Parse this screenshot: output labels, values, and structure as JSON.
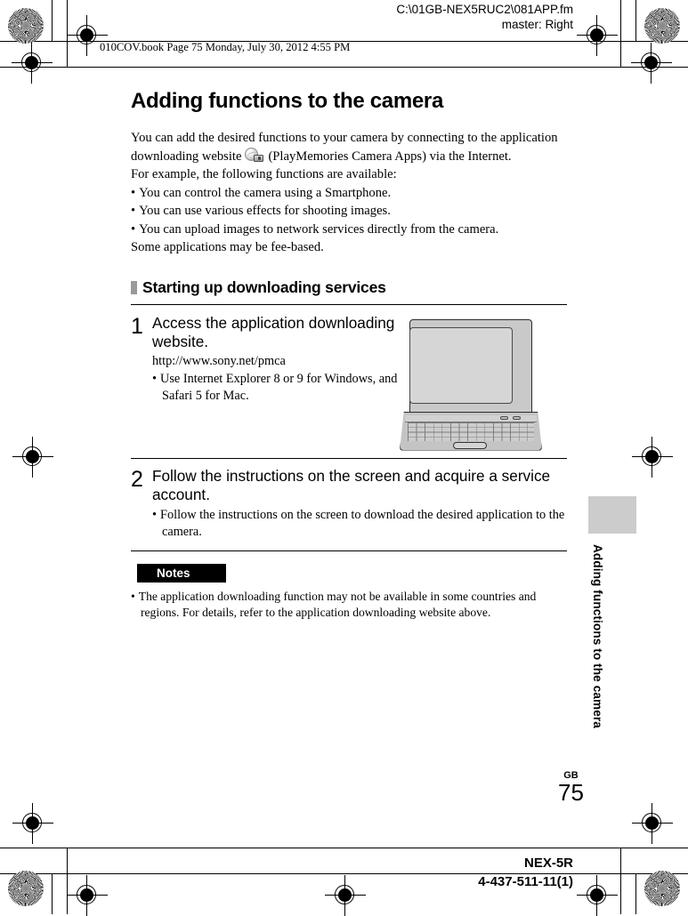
{
  "header": {
    "file_path": "C:\\01GB-NEX5RUC2\\081APP.fm",
    "master": "master: Right",
    "book_line": "010COV.book  Page 75  Monday, July 30, 2012  4:55 PM"
  },
  "page": {
    "title": "Adding functions to the camera",
    "intro_part1": "You can add the desired functions to your camera by connecting to the application downloading website",
    "intro_part2": "(PlayMemories Camera Apps) via the Internet.",
    "for_example": "For example, the following functions are available:",
    "feature_bullets": [
      "You can control the camera using a Smartphone.",
      "You can use various effects for shooting images.",
      "You can upload images to network services directly from the camera."
    ],
    "fee_note": "Some applications may be fee-based."
  },
  "section": {
    "heading": "Starting up downloading services"
  },
  "steps": [
    {
      "number": "1",
      "title": "Access the application downloading website.",
      "url": "http://www.sony.net/pmca",
      "bullets": [
        "Use Internet Explorer 8 or 9 for Windows, and Safari 5 for Mac."
      ]
    },
    {
      "number": "2",
      "title": "Follow the instructions on the screen and acquire a service account.",
      "bullets": [
        "Follow the instructions on the screen to download the desired application to the camera."
      ]
    }
  ],
  "notes": {
    "badge_label": "Notes",
    "items": [
      "The application downloading function may not be available in some countries and regions. For details, refer to the application downloading website above."
    ]
  },
  "side_tab": {
    "label": "Adding functions to the camera"
  },
  "page_number": {
    "region": "GB",
    "number": "75"
  },
  "footer": {
    "model": "NEX-5R",
    "part_number": "4-437-511-11(1)"
  },
  "colors": {
    "section_bar": "#9a9a9a",
    "side_tab": "#cccccc",
    "notes_badge_bg": "#000000",
    "laptop_body": "#c9c9c9"
  }
}
